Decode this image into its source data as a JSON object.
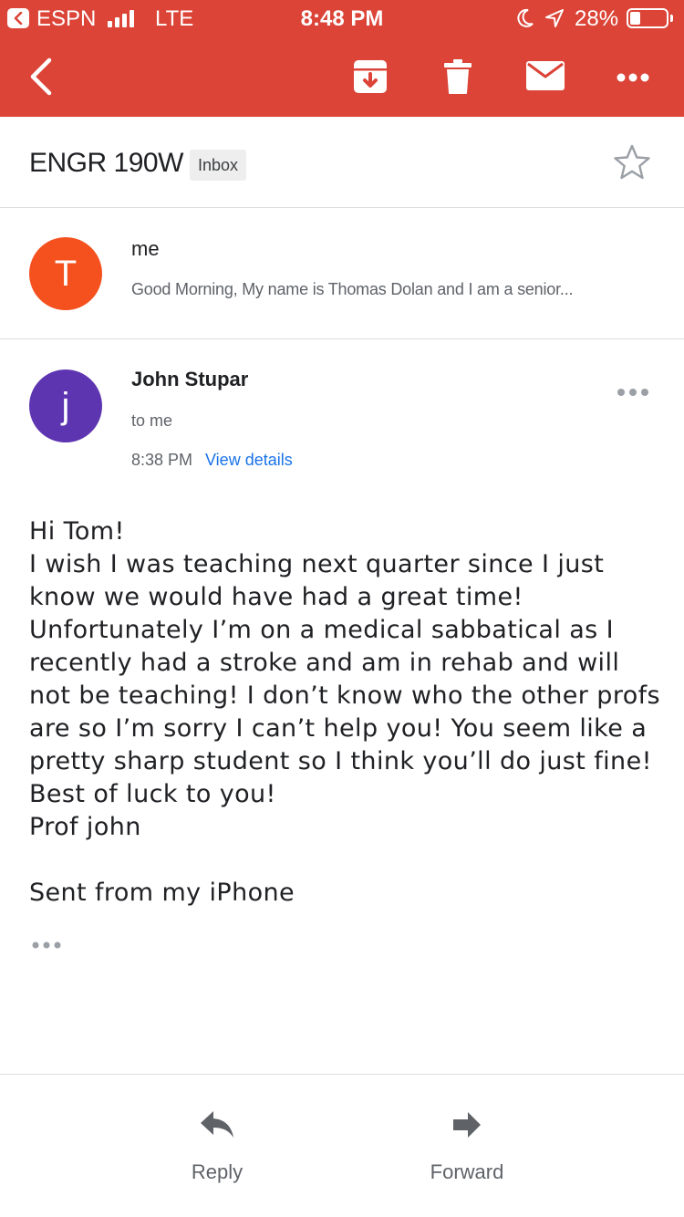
{
  "status_bar": {
    "back_app": "ESPN",
    "network": "LTE",
    "time": "8:48 PM",
    "battery": "28%",
    "battery_level": 0.28
  },
  "toolbar": {
    "back_icon": "chevron-left-icon",
    "archive_icon": "archive-icon",
    "delete_icon": "trash-icon",
    "mark_unread_icon": "mail-icon",
    "more_icon": "more-horizontal-icon"
  },
  "thread": {
    "subject": "ENGR 190W",
    "label": "Inbox"
  },
  "collapsed_message": {
    "avatar_letter": "T",
    "avatar_color": "#f4511e",
    "sender": "me",
    "snippet": "Good Morning, My name is Thomas Dolan and I am a senior..."
  },
  "expanded_message": {
    "avatar_letter": "j",
    "avatar_color": "#5e35b1",
    "sender": "John Stupar",
    "recipient": "to me",
    "time": "8:38 PM",
    "details_link": "View details",
    "body_lines": [
      "Hi Tom!",
      "I wish I was teaching next quarter since I just",
      "know we would have had a great time!",
      "Unfortunately I’m on a medical sabbatical as I",
      "recently had a stroke and am in rehab and will",
      "not be teaching! I don’t know who the other profs",
      "are so I’m sorry I can’t help you! You seem like a",
      "pretty sharp student so I think you’ll do just fine!",
      "Best of luck to you!",
      "Prof john",
      "",
      "Sent from my iPhone"
    ]
  },
  "actions": {
    "reply_label": "Reply",
    "forward_label": "Forward"
  },
  "colors": {
    "header": "#db4437",
    "link": "#1a73e8"
  }
}
